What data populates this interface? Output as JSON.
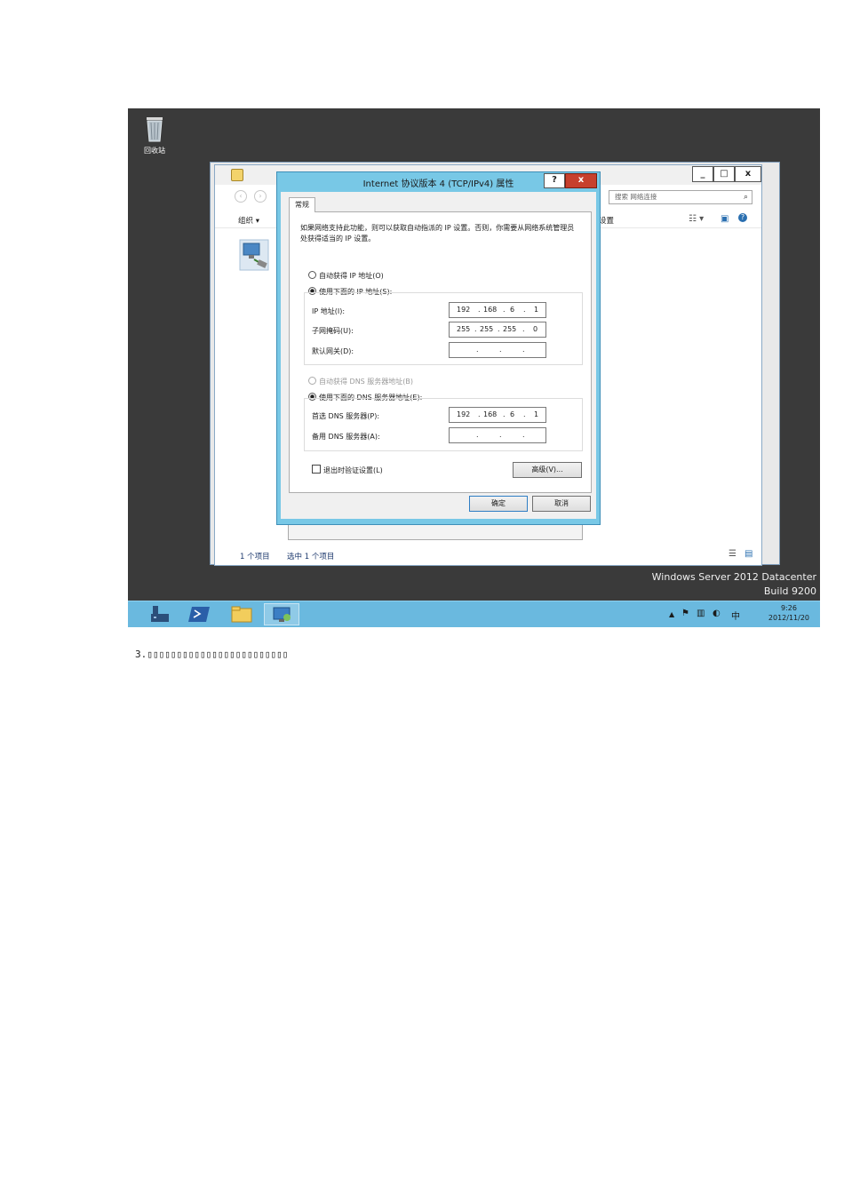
{
  "desktop": {
    "recycle_bin_label": "回收站",
    "watermark_line1": "Windows Server 2012 Datacenter",
    "watermark_line2": "Build 9200"
  },
  "explorer": {
    "search_placeholder": "搜索 网络连接",
    "organize_label": "组织 ▾",
    "settings_fragment": "设置",
    "status_count": "1 个项目",
    "status_selected": "选中 1 个项目"
  },
  "dialog": {
    "title": "Internet 协议版本 4 (TCP/IPv4) 属性",
    "help_label": "?",
    "close_label": "x",
    "tab_general": "常规",
    "description": "如果网络支持此功能，则可以获取自动指派的 IP 设置。否则，你需要从网络系统管理员处获得适当的 IP 设置。",
    "ip_auto_label": "自动获得 IP 地址(O)",
    "ip_manual_label": "使用下面的 IP 地址(S):",
    "ip_address_label": "IP 地址(I):",
    "subnet_label": "子网掩码(U):",
    "gateway_label": "默认网关(D):",
    "ip_address": [
      "192",
      "168",
      "6",
      "1"
    ],
    "subnet_mask": [
      "255",
      "255",
      "255",
      "0"
    ],
    "gateway": [
      "",
      "",
      "",
      ""
    ],
    "dns_auto_label": "自动获得 DNS 服务器地址(B)",
    "dns_manual_label": "使用下面的 DNS 服务器地址(E):",
    "preferred_dns_label": "首选 DNS 服务器(P):",
    "alternate_dns_label": "备用 DNS 服务器(A):",
    "preferred_dns": [
      "192",
      "168",
      "6",
      "1"
    ],
    "alternate_dns": [
      "",
      "",
      "",
      ""
    ],
    "validate_on_exit_label": "退出时验证设置(L)",
    "advanced_button": "高级(V)...",
    "ok_button": "确定",
    "cancel_button": "取消"
  },
  "taskbar": {
    "time": "9:26",
    "date": "2012/11/20",
    "ime_label": "中"
  },
  "document": {
    "caption": "3.▯▯▯▯▯▯▯▯▯▯▯▯▯▯▯▯▯▯▯▯▯▯▯▯"
  },
  "colors": {
    "dialog_frame": "#78c8e6",
    "taskbar": "#6ab9df",
    "desktop": "#3a3a3a",
    "close_button": "#c7402d"
  }
}
